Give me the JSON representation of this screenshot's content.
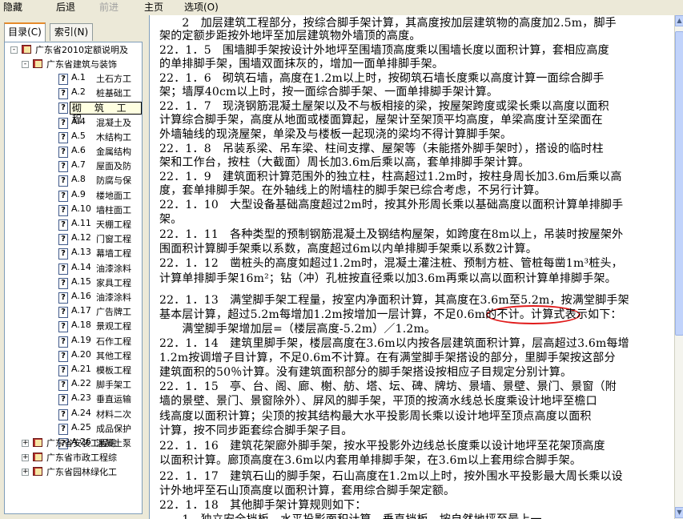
{
  "toolbar": {
    "hide": "隐藏",
    "back": "后退",
    "forward": "前进",
    "home": "主页",
    "options": "选项(O)"
  },
  "tabs": {
    "contents": "目录(C)",
    "index": "索引(N)"
  },
  "tree": {
    "root": "广东省2010定额说明及",
    "building": "广东省建筑与装饰",
    "items": [
      {
        "code": "A.1",
        "label": "土石方工"
      },
      {
        "code": "A.2",
        "label": "桩基础工"
      },
      {
        "code": "A.3",
        "label": "砌 筑 工 程"
      },
      {
        "code": "A.4",
        "label": "混凝土及"
      },
      {
        "code": "A.5",
        "label": "木结构工"
      },
      {
        "code": "A.6",
        "label": "金属结构"
      },
      {
        "code": "A.7",
        "label": "屋面及防"
      },
      {
        "code": "A.8",
        "label": "防腐与保"
      },
      {
        "code": "A.9",
        "label": "楼地面工"
      },
      {
        "code": "A.10",
        "label": "墙柱面工"
      },
      {
        "code": "A.11",
        "label": "天棚工程"
      },
      {
        "code": "A.12",
        "label": "门窗工程"
      },
      {
        "code": "A.13",
        "label": "幕墙工程"
      },
      {
        "code": "A.14",
        "label": "油漆涂料"
      },
      {
        "code": "A.15",
        "label": "家具工程"
      },
      {
        "code": "A.16",
        "label": "油漆涂料"
      },
      {
        "code": "A.17",
        "label": "广告牌工"
      },
      {
        "code": "A.18",
        "label": "景观工程"
      },
      {
        "code": "A.19",
        "label": "石作工程"
      },
      {
        "code": "A.20",
        "label": "其他工程"
      },
      {
        "code": "A.21",
        "label": "模板工程"
      },
      {
        "code": "A.22",
        "label": "脚手架工"
      },
      {
        "code": "A.23",
        "label": "垂直运输"
      },
      {
        "code": "A.24",
        "label": "材料二次"
      },
      {
        "code": "A.25",
        "label": "成品保护"
      },
      {
        "code": "A.26",
        "label": "混凝土泵"
      }
    ],
    "tooltip": "砌 筑 工 程",
    "install": "广东省安装工程综",
    "municipal": "广东省市政工程综",
    "garden": "广东省园林绿化工"
  },
  "content": {
    "lines": [
      "　　2　加层建筑工程部分，按综合脚手架计算，其高度按加层建筑物的高度加2.5m，脚手",
      "架的定额步距按外地坪至加层建筑物外墙顶的高度。",
      "22．1．5　围墙脚手架按设计外地坪至围墙顶高度乘以围墙长度以面积计算，套相应高度",
      "的单排脚手架，围墙双面抹灰的，增加一面单排脚手架。",
      "22．1．6　砌筑石墙，高度在1.2m以上时，按砌筑石墙长度乘以高度计算一面综合脚手",
      "架；墙厚40cm以上时，按一面综合脚手架、一面单排脚手架计算。",
      "22．1．7　现浇钢筋混凝土屋架以及不与板相接的梁，按屋架跨度或梁长乘以高度以面积",
      "计算综合脚手架，高度从地面或楼面算起，屋架计至架顶平均高度，单梁高度计至梁面在",
      "外墙轴线的现浇屋架，单梁及与楼板一起现浇的梁均不得计算脚手架。",
      "22．1．8　吊装系梁、吊车梁、柱间支撑、屋架等（未能搭外脚手架时），搭设的临时柱",
      "架和工作台，按柱（大截面）周长加3.6m后乘以高，套单排脚手架计算。",
      "22．1．9　建筑面积计算范围外的独立柱，柱高超过1.2m时，按柱身周长加3.6m后乘以高",
      "度，套单排脚手架。在外轴线上的附墙柱的脚手架已综合考虑，不另行计算。",
      "22．1．10　大型设备基础高度超过2m时，按其外形周长乘以基础高度以面积计算单排脚手",
      "架。",
      "22．1．11　各种类型的预制钢筋混凝土及钢结构屋架，如跨度在8m以上，吊装时按屋架外",
      "围面积计算脚手架乘以系数，高度超过6m以内单排脚手架乘以系数2计算。",
      "22．1．12　凿桩头的高度如超过1.2m时，混凝土灌注桩、预制方桩、管桩每凿1m³桩头，",
      "计算单排脚手架16m²；钻（冲）孔桩按直径乘以加3.6m再乘以高以面积计算单排脚手架。",
      "22．1．13　满堂脚手架工程量，按室内净面积计算，其高度在3.6m至5.2m，按满堂脚手架",
      "基本层计算，超过5.2m每增加1.2m按增加一层计算，不足0.6m的不计。计算式表示如下：",
      "　　满堂脚手架增加层=（楼层高度-5.2m）／1.2m。",
      "22．1．14　建筑里脚手架，楼层高度在3.6m以内按各层建筑面积计算，层高超过3.6m每增",
      "1.2m按调增子目计算，不足0.6m不计算。在有满堂脚手架搭设的部分，里脚手架按这部分",
      "建筑面积的50％计算。没有建筑面积部分的脚手架搭设按相应子目规定分别计算。",
      "22．1．15　亭、台、阁、廊、榭、舫、塔、坛、碑、牌坊、景墙、景壁、景门、景窗（附",
      "墙的景壁、景门、景窗除外）、屏风的脚手架，平顶的按滴水线总长度乘设计地坪至檐口",
      "线高度以面积计算；尖顶的按其结构最大水平投影周长乘以设计地坪至顶点高度以面积",
      "计算，按不同步距套综合脚手架子目。",
      "22．1．16　建筑花架廊外脚手架，按水平投影外边线总长度乘以设计地坪至花架顶高度",
      "以面积计算。廊顶高度在3.6m以内套用单排脚手架，在3.6m以上套用综合脚手架。",
      "22．1．17　建筑石山的脚手架，石山高度在1.2m以上时，按外围水平投影最大周长乘以设",
      "计外地坪至石山顶高度以面积计算，套用综合脚手架定额。",
      "22．1．18　其他脚手架计算规则如下：",
      "　　1　独立安全挡板、水平投影面积计算，垂直挡板，按自然地坪至最上一"
    ]
  }
}
